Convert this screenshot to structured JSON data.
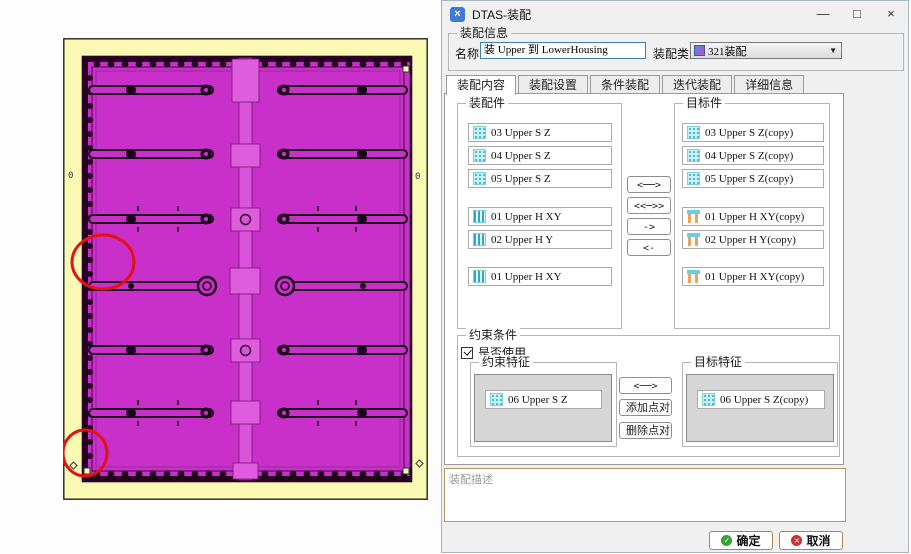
{
  "window": {
    "title": "DTAS-装配",
    "app_icon_glyph": "×",
    "minimize_glyph": "—",
    "maximize_glyph": "□",
    "close_glyph": "×"
  },
  "assembly_info": {
    "group_label": "装配信息",
    "name_label": "名称:",
    "name_value": "装 Upper 到 LowerHousing",
    "type_label": "装配类型:",
    "type_value": "321装配",
    "caret_glyph": "▼"
  },
  "tabs": [
    {
      "label": "装配内容",
      "active": true
    },
    {
      "label": "装配设置",
      "active": false
    },
    {
      "label": "条件装配",
      "active": false
    },
    {
      "label": "迭代装配",
      "active": false
    },
    {
      "label": "详细信息",
      "active": false
    }
  ],
  "content": {
    "source_group_label": "装配件",
    "target_group_label": "目标件",
    "source_items": [
      {
        "icon": "surface-feature-icon",
        "label": "03 Upper S Z"
      },
      {
        "icon": "surface-feature-icon",
        "label": "04 Upper S Z"
      },
      {
        "icon": "surface-feature-icon",
        "label": "05 Upper S Z"
      },
      {
        "icon": "hole-feature-icon",
        "label": "01 Upper H XY"
      },
      {
        "icon": "hole-feature-icon",
        "label": "02 Upper H Y"
      },
      {
        "icon": "hole-feature-icon",
        "label": "01 Upper H XY"
      }
    ],
    "target_items": [
      {
        "icon": "surface-feature-icon",
        "label": "03 Upper S Z(copy)"
      },
      {
        "icon": "surface-feature-icon",
        "label": "04 Upper S Z(copy)"
      },
      {
        "icon": "surface-feature-icon",
        "label": "05 Upper S Z(copy)"
      },
      {
        "icon": "pin-feature-icon",
        "label": "01 Upper H XY(copy)"
      },
      {
        "icon": "pin-feature-icon",
        "label": "02 Upper H Y(copy)"
      },
      {
        "icon": "pin-feature-icon",
        "label": "01 Upper H XY(copy)"
      }
    ],
    "transfer_buttons": [
      "<──>",
      "<<─>>",
      "->",
      "<-"
    ]
  },
  "constraints": {
    "group_label": "约束条件",
    "use_checkbox_label": "是否使用",
    "checked": true,
    "source_group_label": "约束特征",
    "target_group_label": "目标特征",
    "source_item": {
      "icon": "surface-feature-icon",
      "label": "06 Upper S Z"
    },
    "target_item": {
      "icon": "surface-feature-icon",
      "label": "06 Upper S Z(copy)"
    },
    "link_button": "<──>",
    "add_pair_button": "添加点对",
    "delete_pair_button": "删除点对"
  },
  "description": {
    "placeholder": "装配描述"
  },
  "footer": {
    "ok_label": "确定",
    "cancel_label": "取消"
  },
  "viewport": {
    "markers": {
      "left": "0",
      "right": "0"
    }
  },
  "colors": {
    "accent_blue": "#3e7bd6",
    "part_magenta": "#c92fc9",
    "canvas_yellow": "#f9f9b4",
    "annotation_red": "#e51212",
    "button_border_tan": "#a58858",
    "ok_icon_green": "#33a532",
    "cancel_icon_red": "#d23030",
    "feature_icon_cyan": "#7fd8e8",
    "feature_icon_orange": "#e8a45c"
  }
}
